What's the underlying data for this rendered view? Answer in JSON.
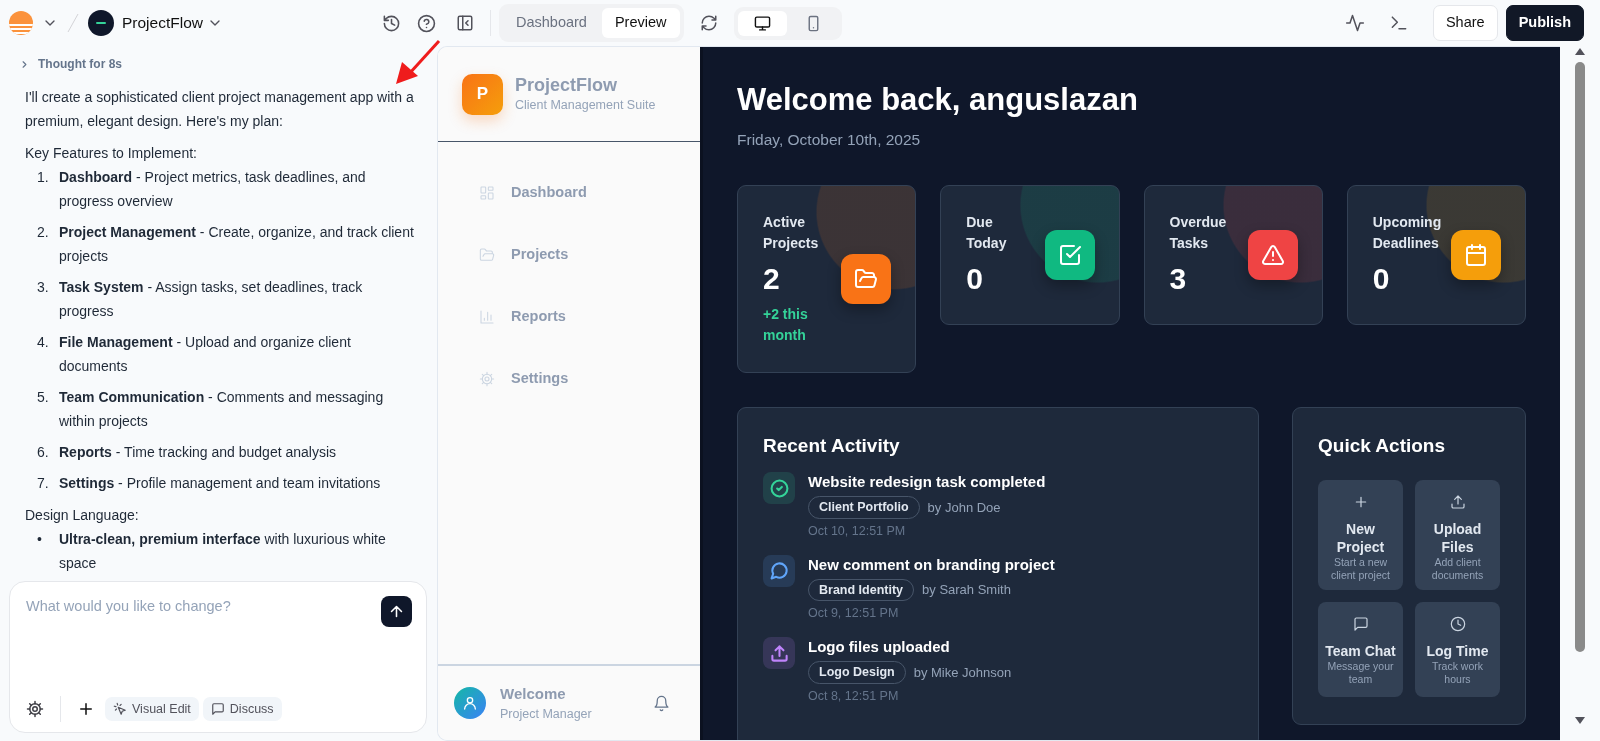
{
  "topbar": {
    "project_name": "ProjectFlow",
    "view_tabs": [
      {
        "label": "Dashboard",
        "selected": false
      },
      {
        "label": "Preview",
        "selected": true
      }
    ],
    "devices": [
      {
        "selected": true
      },
      {
        "selected": false
      }
    ],
    "buttons": [
      {
        "label": "Share",
        "kind": "secondary"
      },
      {
        "label": "Publish",
        "kind": "primary"
      }
    ]
  },
  "chat": {
    "thought": "Thought for 8s",
    "intro": "I'll create a sophisticated client project management app with a premium, elegant design. Here's my plan:",
    "features_heading": "Key Features to Implement:",
    "features": [
      {
        "number": "1.",
        "text": "**Dashboard** - Project metrics, task deadlines, and progress overview"
      },
      {
        "number": "2.",
        "text": "**Project Management** - Create, organize, and track client projects"
      },
      {
        "number": "3.",
        "text": "**Task System** - Assign tasks, set deadlines, track progress"
      },
      {
        "number": "4.",
        "text": "**File Management** - Upload and organize client documents"
      },
      {
        "number": "5.",
        "text": "**Team Communication** - Comments and messaging within projects"
      },
      {
        "number": "6.",
        "text": "**Reports** - Time tracking and budget analysis"
      },
      {
        "number": "7.",
        "text": "**Settings** - Profile management and team invitations"
      }
    ],
    "design_heading": "Design Language:",
    "design_points": [
      {
        "bullet": "•",
        "text": "**Ultra-clean, premium interface** with luxurious white space"
      }
    ],
    "composer": {
      "placeholder": "What would you like to change?",
      "tools": [
        "Visual Edit",
        "Discuss"
      ]
    }
  },
  "app": {
    "sidebar": {
      "logo_letter": "P",
      "brand": "ProjectFlow",
      "tagline": "Client Management Suite",
      "nav": [
        "Dashboard",
        "Projects",
        "Reports",
        "Settings"
      ],
      "user": {
        "name": "Welcome",
        "role": "Project Manager"
      }
    },
    "heading": "Welcome back, anguslazan",
    "date": "Friday, October 10th, 2025",
    "stats": [
      {
        "label": "Active Projects",
        "value": "2",
        "note": "+2 this month",
        "color": "#f97316"
      },
      {
        "label": "Due Today",
        "value": "0",
        "color": "#10b981"
      },
      {
        "label": "Overdue Tasks",
        "value": "3",
        "color": "#ef4444"
      },
      {
        "label": "Upcoming Deadlines",
        "value": "0",
        "color": "#f59e0b"
      }
    ],
    "activity": {
      "title": "Recent Activity",
      "items": [
        {
          "title": "Website redesign task completed",
          "tag": "Client Portfolio",
          "by": "by John Doe",
          "time": "Oct 10, 12:51 PM",
          "color": "#34d399"
        },
        {
          "title": "New comment on branding project",
          "tag": "Brand Identity",
          "by": "by Sarah Smith",
          "time": "Oct 9, 12:51 PM",
          "color": "#60a5fa"
        },
        {
          "title": "Logo files uploaded",
          "tag": "Logo Design",
          "by": "by Mike Johnson",
          "time": "Oct 8, 12:51 PM",
          "color": "#c084fc"
        }
      ]
    },
    "quick_actions": {
      "title": "Quick Actions",
      "items": [
        {
          "label": "New Project",
          "description": "Start a new client project"
        },
        {
          "label": "Upload Files",
          "description": "Add client documents"
        },
        {
          "label": "Team Chat",
          "description": "Message your team"
        },
        {
          "label": "Log Time",
          "description": "Track work hours"
        }
      ]
    }
  }
}
